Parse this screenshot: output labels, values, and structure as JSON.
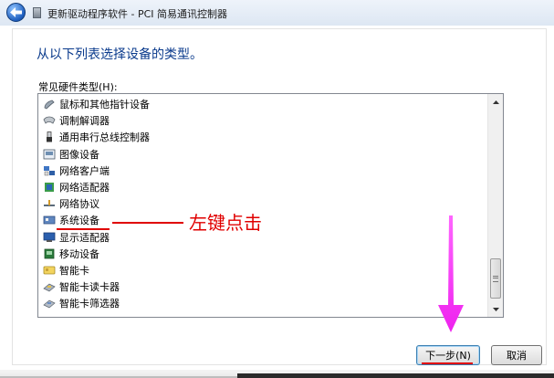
{
  "window": {
    "title": "更新驱动程序软件 - PCI 简易通讯控制器"
  },
  "main": {
    "heading": "从以下列表选择设备的类型。",
    "list_label": "常见硬件类型(H):",
    "items": [
      {
        "label": "鼠标和其他指针设备",
        "icon": "mouse-icon"
      },
      {
        "label": "调制解调器",
        "icon": "modem-icon"
      },
      {
        "label": "通用串行总线控制器",
        "icon": "usb-icon"
      },
      {
        "label": "图像设备",
        "icon": "imaging-device-icon"
      },
      {
        "label": "网络客户端",
        "icon": "network-client-icon"
      },
      {
        "label": "网络适配器",
        "icon": "network-adapter-icon"
      },
      {
        "label": "网络协议",
        "icon": "network-protocol-icon"
      },
      {
        "label": "系统设备",
        "icon": "system-device-icon"
      },
      {
        "label": "显示适配器",
        "icon": "display-adapter-icon"
      },
      {
        "label": "移动设备",
        "icon": "mobile-device-icon"
      },
      {
        "label": "智能卡",
        "icon": "smart-card-icon"
      },
      {
        "label": "智能卡读卡器",
        "icon": "smart-card-reader-icon"
      },
      {
        "label": "智能卡筛选器",
        "icon": "smart-card-filter-icon"
      }
    ]
  },
  "annotation": {
    "text": "左键点击",
    "color": "#e00000",
    "arrow_color": "#ff33ff"
  },
  "buttons": {
    "next_label": "下一步(N)",
    "cancel_label": "取消"
  },
  "colors": {
    "heading": "#0a3a8c",
    "accent": "#3c7fb1"
  }
}
